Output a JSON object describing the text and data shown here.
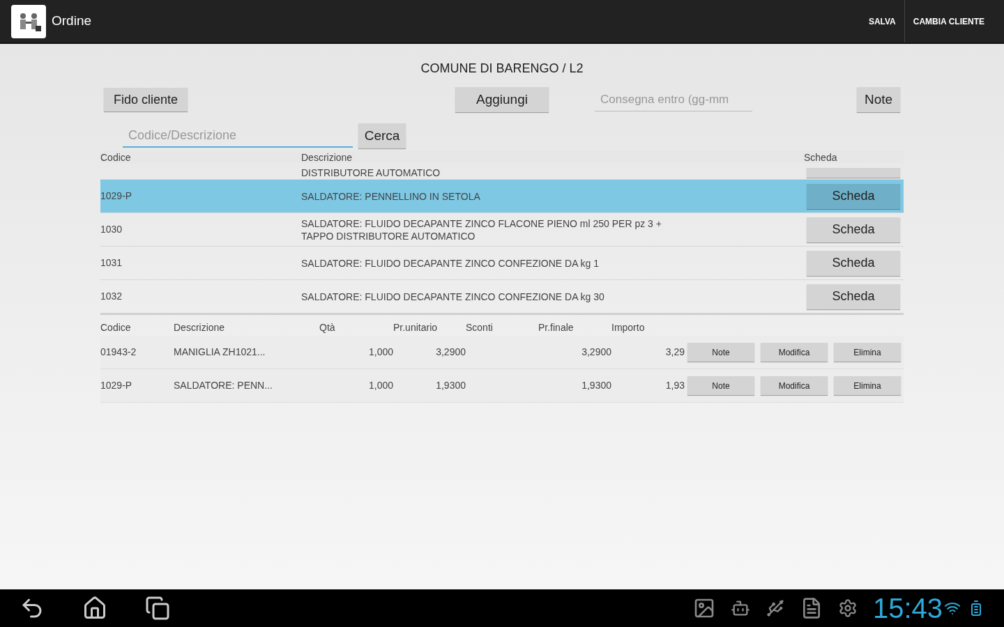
{
  "action_bar": {
    "title": "Ordine",
    "actions": [
      "SALVA",
      "CAMBIA CLIENTE"
    ]
  },
  "customer": "COMUNE DI BARENGO / L2",
  "toolbar": {
    "credit_button": "Fido cliente",
    "add_button": "Aggiungi",
    "delivery_field": {
      "placeholder": "Consegna entro (gg-mm"
    },
    "notes_button": "Note"
  },
  "search": {
    "placeholder": "Codice/Descrizione",
    "button": "Cerca"
  },
  "products": {
    "columns": [
      "Codice",
      "Descrizione",
      "Scheda"
    ],
    "rows": [
      {
        "description": "DISTRIBUTORE AUTOMATICO",
        "partial": true,
        "selected": false
      },
      {
        "code": "1029-P",
        "description": "SALDATORE: PENNELLINO IN SETOLA",
        "button": "Scheda",
        "partial": false,
        "selected": true
      },
      {
        "code": "1030",
        "description": "SALDATORE: FLUIDO DECAPANTE ZINCO FLACONE PIENO ml 250 PER pz 3 + TAPPO DISTRIBUTORE AUTOMATICO",
        "button": "Scheda",
        "partial": false,
        "selected": false
      },
      {
        "code": "1031",
        "description": "SALDATORE: FLUIDO DECAPANTE ZINCO CONFEZIONE DA kg 1",
        "button": "Scheda",
        "partial": false,
        "selected": false
      },
      {
        "code": "1032",
        "description": "SALDATORE: FLUIDO DECAPANTE ZINCO CONFEZIONE DA kg 30",
        "button": "Scheda",
        "partial": false,
        "selected": false
      }
    ]
  },
  "order_lines": {
    "columns": [
      "Codice",
      "Descrizione",
      "Qtà",
      "Pr.unitario",
      "Sconti",
      "Pr.finale",
      "Importo"
    ],
    "rows": [
      {
        "code": "01943-2",
        "description": "MANIGLIA ZH1021...",
        "qty": "1,000",
        "unit_price": "3,2900",
        "final_price": "3,2900",
        "amount": "3,29",
        "buttons": [
          "Note",
          "Modifica",
          "Elimina"
        ]
      },
      {
        "code": "1029-P",
        "description": "SALDATORE: PENN...",
        "qty": "1,000",
        "unit_price": "1,9300",
        "final_price": "1,9300",
        "amount": "1,93",
        "buttons": [
          "Note",
          "Modifica",
          "Elimina"
        ]
      }
    ]
  },
  "system_bar": {
    "time": "15:43"
  }
}
